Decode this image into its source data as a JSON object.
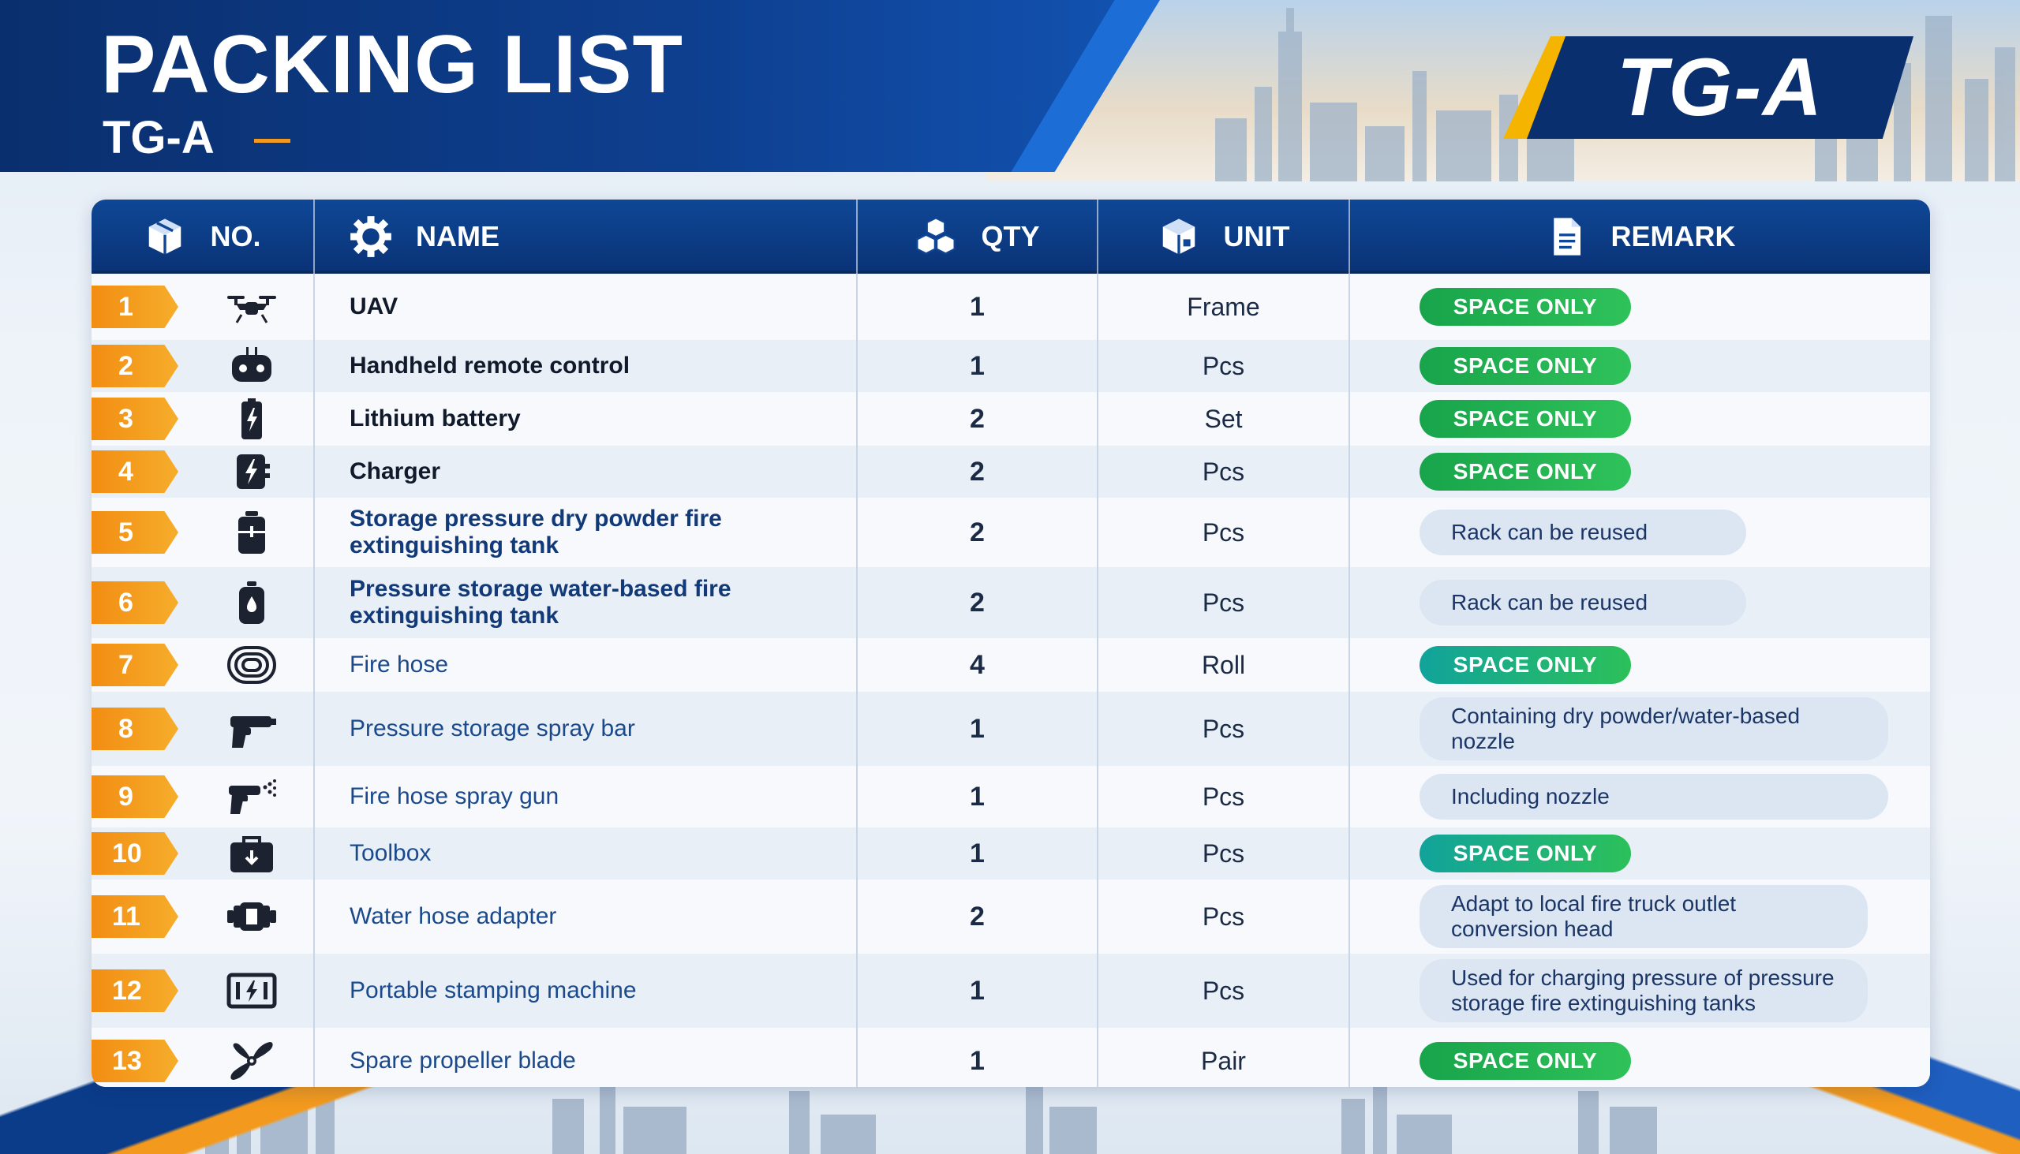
{
  "header": {
    "title": "PACKING LIST",
    "subtitle": "TG-A",
    "logo_text": "TG-A"
  },
  "colors": {
    "navy": "#0a2f6e",
    "accent_blue": "#1c6ed6",
    "orange": "#f39a1e",
    "green": "#2fc25a"
  },
  "table": {
    "headers": [
      {
        "label": "NO.",
        "icon": "box-icon"
      },
      {
        "label": "NAME",
        "icon": "gear-icon"
      },
      {
        "label": "QTY",
        "icon": "stacked-boxes-icon"
      },
      {
        "label": "UNIT",
        "icon": "package-icon"
      },
      {
        "label": "REMARK",
        "icon": "document-icon"
      }
    ],
    "rows": [
      {
        "no": "1",
        "icon": "drone-icon",
        "name": "UAV",
        "qty": "1",
        "unit": "Frame",
        "remark": "SPACE ONLY",
        "remark_type": "pill"
      },
      {
        "no": "2",
        "icon": "remote-control-icon",
        "name": "Handheld remote control",
        "qty": "1",
        "unit": "Pcs",
        "remark": "SPACE ONLY",
        "remark_type": "pill"
      },
      {
        "no": "3",
        "icon": "battery-icon",
        "name": "Lithium battery",
        "qty": "2",
        "unit": "Set",
        "remark": "SPACE ONLY",
        "remark_type": "pill"
      },
      {
        "no": "4",
        "icon": "charger-icon",
        "name": "Charger",
        "qty": "2",
        "unit": "Pcs",
        "remark": "SPACE ONLY",
        "remark_type": "pill"
      },
      {
        "no": "5",
        "icon": "tank-icon",
        "name": "Storage pressure dry powder fire extinguishing tank",
        "qty": "2",
        "unit": "Pcs",
        "remark": "Rack can be reused",
        "remark_type": "note"
      },
      {
        "no": "6",
        "icon": "water-tank-icon",
        "name": "Pressure storage water-based fire extinguishing tank",
        "qty": "2",
        "unit": "Pcs",
        "remark": "Rack can be reused",
        "remark_type": "note"
      },
      {
        "no": "7",
        "icon": "hose-coil-icon",
        "name": "Fire hose",
        "qty": "4",
        "unit": "Roll",
        "remark": "SPACE ONLY",
        "remark_type": "pill-teal"
      },
      {
        "no": "8",
        "icon": "spray-bar-icon",
        "name": "Pressure storage spray bar",
        "qty": "1",
        "unit": "Pcs",
        "remark": "Containing dry powder/water-based nozzle",
        "remark_type": "note"
      },
      {
        "no": "9",
        "icon": "spray-gun-icon",
        "name": "Fire hose spray gun",
        "qty": "1",
        "unit": "Pcs",
        "remark": "Including nozzle",
        "remark_type": "note"
      },
      {
        "no": "10",
        "icon": "toolbox-icon",
        "name": "Toolbox",
        "qty": "1",
        "unit": "Pcs",
        "remark": "SPACE ONLY",
        "remark_type": "pill-teal"
      },
      {
        "no": "11",
        "icon": "adapter-icon",
        "name": "Water hose adapter",
        "qty": "2",
        "unit": "Pcs",
        "remark": "Adapt to local fire truck outlet conversion head",
        "remark_type": "note"
      },
      {
        "no": "12",
        "icon": "pump-machine-icon",
        "name": "Portable stamping machine",
        "qty": "1",
        "unit": "Pcs",
        "remark": "Used for charging pressure of pressure storage fire extinguishing tanks",
        "remark_type": "note"
      },
      {
        "no": "13",
        "icon": "propeller-icon",
        "name": "Spare propeller blade",
        "qty": "1",
        "unit": "Pair",
        "remark": "SPACE ONLY",
        "remark_type": "pill"
      }
    ]
  }
}
